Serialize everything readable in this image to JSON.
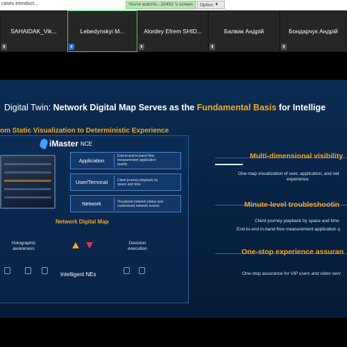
{
  "window": {
    "tab_title": "cases introduct...",
    "share_banner": "You're watchis...32452 's screen.",
    "option_label": "Option",
    "option_icon": "chevron-down-icon"
  },
  "participants": [
    {
      "name": "SAHAIDAK_Vik...",
      "active": false,
      "mic": "muted"
    },
    {
      "name": "Lebedynskyi M...",
      "active": true,
      "mic": "blue"
    },
    {
      "name": "Alordey Efrem SHID...",
      "active": false,
      "mic": "muted"
    },
    {
      "name": "Балвак Андрій",
      "active": false,
      "mic": "muted"
    },
    {
      "name": "Бондарчук Андрій",
      "active": false,
      "mic": "muted"
    }
  ],
  "slide": {
    "title_prefix": "Digital Twin: ",
    "title_main": "Network Digital Map Serves as the ",
    "title_highlight": "Fundamental Basis",
    "title_suffix": " for Intellige",
    "subtitle": "om Static Visualization to Deterministic Experience",
    "brand_name": "iMaster",
    "brand_sub": "NCE",
    "layers": [
      {
        "name": "Application",
        "desc": [
          "End-to-end in-band flow",
          "measurement application",
          "quality"
        ]
      },
      {
        "name": "User/Terminal",
        "desc": [
          "Client journey playback by",
          "space and time"
        ]
      },
      {
        "name": "Network",
        "desc": [
          "Visualized network status and",
          "customized network screen"
        ]
      }
    ],
    "ndm_label": "Network Digital Map",
    "holographic": "Holographic awareness",
    "decision": "Decision execution",
    "intelligent_nes": "Intelligent NEs",
    "right": {
      "h1": "Multi-dimensional visibility",
      "t1a": "One-map visualization of user, application, and net",
      "t1b": "experience",
      "h2": "Minute-level troubleshootin",
      "t2a": "Client journey playback by space and time",
      "t2b": "End-to-end in-band flow measurement application q",
      "h3": "One-stop experience assuran",
      "t3a": "One-stop assurance for VIP users and  video serv"
    },
    "colors": {
      "accent": "#f5a623",
      "background": "#072447",
      "active_border": "#3ddc6b"
    }
  }
}
